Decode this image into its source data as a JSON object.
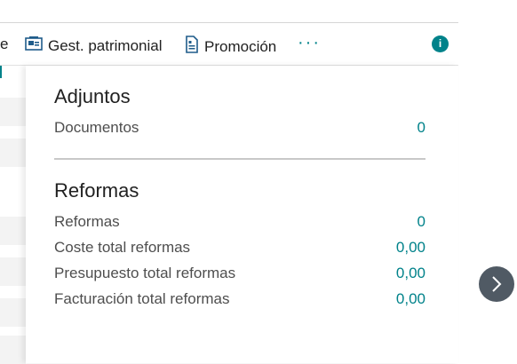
{
  "action_bar": {
    "truncated_label": "e",
    "gest_patrimonial": "Gest. patrimonial",
    "promocion": "Promoción",
    "more": "···",
    "info": "i"
  },
  "factbox": {
    "adjuntos": {
      "title": "Adjuntos",
      "rows": [
        {
          "label": "Documentos",
          "value": "0"
        }
      ]
    },
    "reformas": {
      "title": "Reformas",
      "rows": [
        {
          "label": "Reformas",
          "value": "0"
        },
        {
          "label": "Coste total reformas",
          "value": "0,00"
        },
        {
          "label": "Presupuesto total reformas",
          "value": "0,00"
        },
        {
          "label": "Facturación total reformas",
          "value": "0,00"
        }
      ]
    }
  },
  "colors": {
    "accent": "#00828a",
    "nav_button": "#505a64"
  }
}
